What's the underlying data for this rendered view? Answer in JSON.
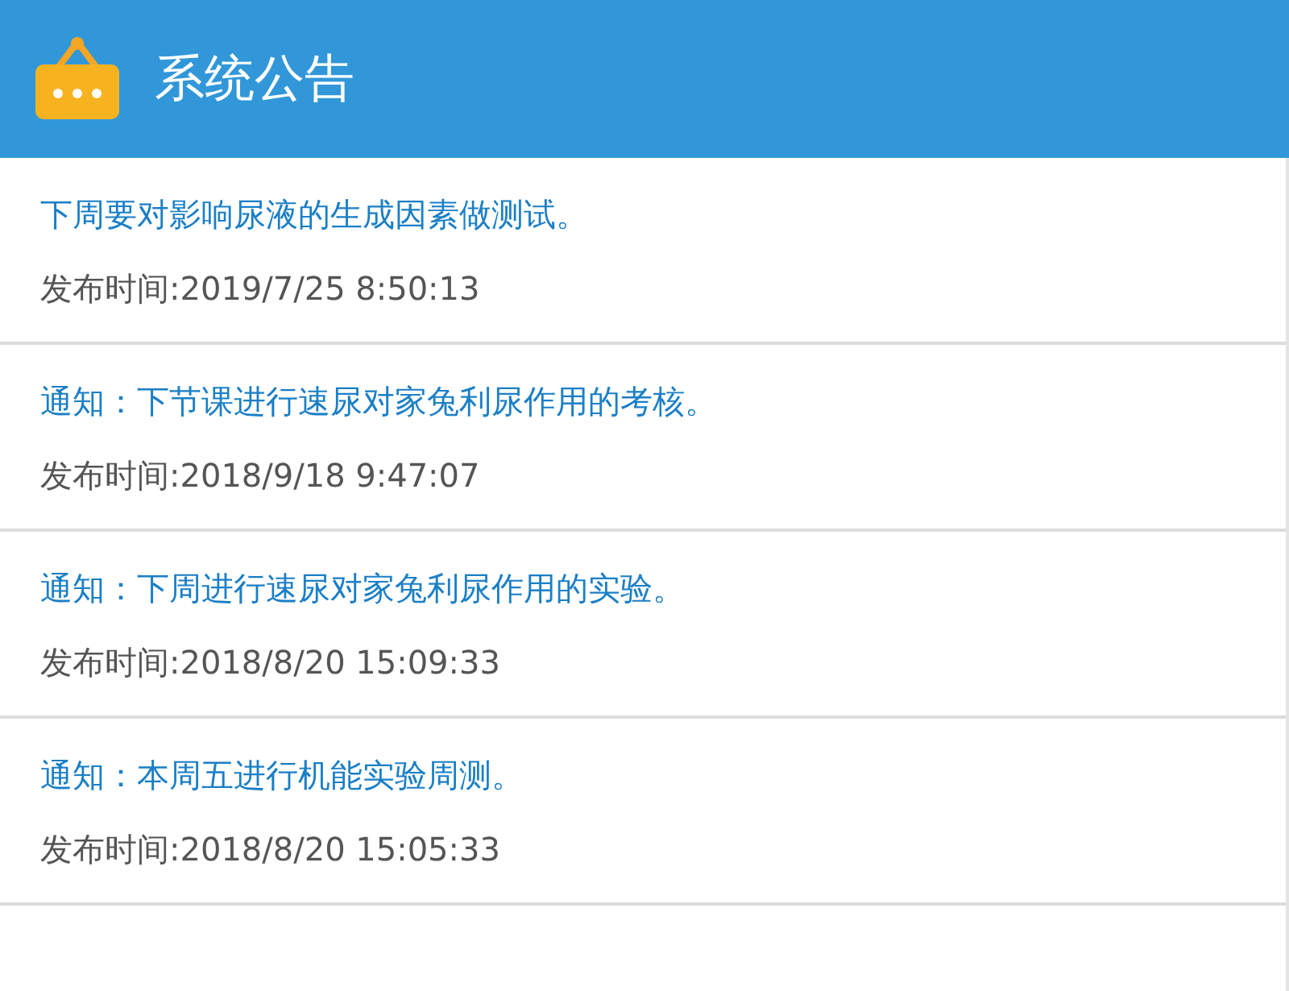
{
  "header": {
    "title": "系统公告"
  },
  "notices": [
    {
      "title": "下周要对影响尿液的生成因素做测试。",
      "date": "发布时间:2019/7/25 8:50:13"
    },
    {
      "title": "通知：下节课进行速尿对家兔利尿作用的考核。",
      "date": "发布时间:2018/9/18 9:47:07"
    },
    {
      "title": "通知：下周进行速尿对家兔利尿作用的实验。",
      "date": "发布时间:2018/8/20 15:09:33"
    },
    {
      "title": "通知：本周五进行机能实验周测。",
      "date": "发布时间:2018/8/20 15:05:33"
    }
  ]
}
